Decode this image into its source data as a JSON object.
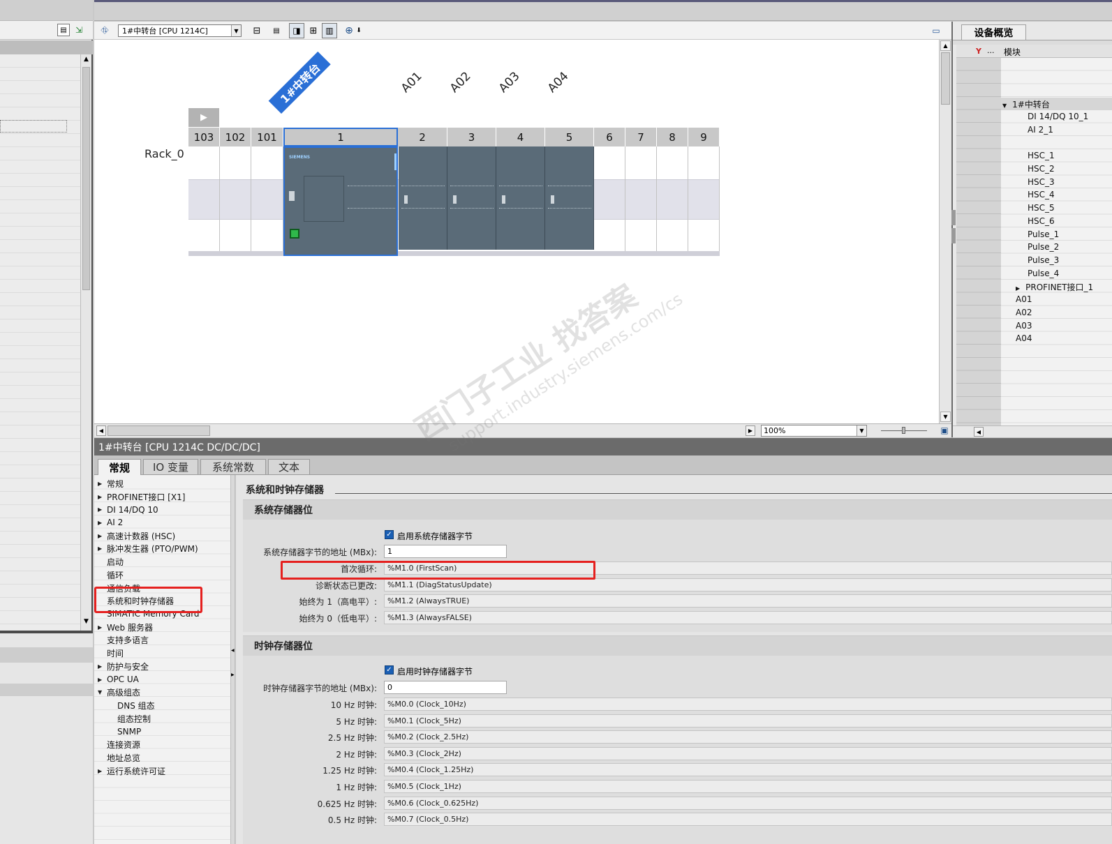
{
  "toolbar": {
    "device_select": "1#中转台 [CPU 1214C]",
    "zoom_value": "100%"
  },
  "rack": {
    "label": "Rack_0",
    "device_banner": "1#中转台",
    "slot_numbers": [
      "103",
      "102",
      "101",
      "1",
      "2",
      "3",
      "4",
      "5",
      "6",
      "7",
      "8",
      "9"
    ],
    "module_labels": [
      "A01",
      "A02",
      "A03",
      "A04"
    ],
    "cpu_brand": "SIEMENS"
  },
  "overview": {
    "tab_title": "设备概览",
    "col_module": "模块",
    "col_ellipsis": "...",
    "rows": [
      "1#中转台",
      "DI 14/DQ 10_1",
      "AI 2_1",
      "",
      "HSC_1",
      "HSC_2",
      "HSC_3",
      "HSC_4",
      "HSC_5",
      "HSC_6",
      "Pulse_1",
      "Pulse_2",
      "Pulse_3",
      "Pulse_4",
      "PROFINET接口_1",
      "A01",
      "A02",
      "A03",
      "A04"
    ]
  },
  "inspector": {
    "title": "1#中转台 [CPU 1214C DC/DC/DC]",
    "tabs": [
      "常规",
      "IO 变量",
      "系统常数",
      "文本"
    ],
    "nav": [
      {
        "label": "常规",
        "arrow": "▶"
      },
      {
        "label": "PROFINET接口 [X1]",
        "arrow": "▶"
      },
      {
        "label": "DI 14/DQ 10",
        "arrow": "▶"
      },
      {
        "label": "AI 2",
        "arrow": "▶"
      },
      {
        "label": "高速计数器 (HSC)",
        "arrow": "▶"
      },
      {
        "label": "脉冲发生器 (PTO/PWM)",
        "arrow": "▶"
      },
      {
        "label": "启动",
        "arrow": ""
      },
      {
        "label": "循环",
        "arrow": ""
      },
      {
        "label": "通信负载",
        "arrow": ""
      },
      {
        "label": "系统和时钟存储器",
        "arrow": ""
      },
      {
        "label": "SIMATIC Memory Card",
        "arrow": ""
      },
      {
        "label": "Web 服务器",
        "arrow": "▶"
      },
      {
        "label": "支持多语言",
        "arrow": ""
      },
      {
        "label": "时间",
        "arrow": ""
      },
      {
        "label": "防护与安全",
        "arrow": "▶"
      },
      {
        "label": "OPC UA",
        "arrow": "▶"
      },
      {
        "label": "高级组态",
        "arrow": "▼"
      },
      {
        "label": "DNS 组态",
        "arrow": "",
        "indent": true
      },
      {
        "label": "组态控制",
        "arrow": "",
        "indent": true
      },
      {
        "label": "SNMP",
        "arrow": "",
        "indent": true
      },
      {
        "label": "连接资源",
        "arrow": ""
      },
      {
        "label": "地址总览",
        "arrow": ""
      },
      {
        "label": "运行系统许可证",
        "arrow": "▶"
      }
    ],
    "section_title": "系统和时钟存储器",
    "sys": {
      "heading": "系统存储器位",
      "enable_label": "启用系统存储器字节",
      "addr_label": "系统存储器字节的地址 (MBx):",
      "addr_value": "1",
      "rows": [
        {
          "label": "首次循环:",
          "value": "%M1.0 (FirstScan)"
        },
        {
          "label": "诊断状态已更改:",
          "value": "%M1.1 (DiagStatusUpdate)"
        },
        {
          "label": "始终为 1（高电平）:",
          "value": "%M1.2 (AlwaysTRUE)"
        },
        {
          "label": "始终为 0（低电平）:",
          "value": "%M1.3 (AlwaysFALSE)"
        }
      ]
    },
    "clk": {
      "heading": "时钟存储器位",
      "enable_label": "启用时钟存储器字节",
      "addr_label": "时钟存储器字节的地址 (MBx):",
      "addr_value": "0",
      "rows": [
        {
          "label": "10 Hz 时钟:",
          "value": "%M0.0 (Clock_10Hz)"
        },
        {
          "label": "5 Hz 时钟:",
          "value": "%M0.1 (Clock_5Hz)"
        },
        {
          "label": "2.5 Hz 时钟:",
          "value": "%M0.2 (Clock_2.5Hz)"
        },
        {
          "label": "2 Hz 时钟:",
          "value": "%M0.3 (Clock_2Hz)"
        },
        {
          "label": "1.25 Hz 时钟:",
          "value": "%M0.4 (Clock_1.25Hz)"
        },
        {
          "label": "1 Hz 时钟:",
          "value": "%M0.5 (Clock_1Hz)"
        },
        {
          "label": "0.625 Hz 时钟:",
          "value": "%M0.6 (Clock_0.625Hz)"
        },
        {
          "label": "0.5 Hz 时钟:",
          "value": "%M0.7 (Clock_0.5Hz)"
        }
      ]
    }
  },
  "watermark": {
    "line1": "西门子工业  找答案",
    "line2": "support.industry.siemens.com/cs"
  },
  "colors": {
    "highlight_red": "#e5201f",
    "banner_blue": "#2a6fd6",
    "module_gray": "#5a6b78",
    "cpu_select_border": "#2a6fd6",
    "checkbox_blue": "#1a5fb4"
  }
}
